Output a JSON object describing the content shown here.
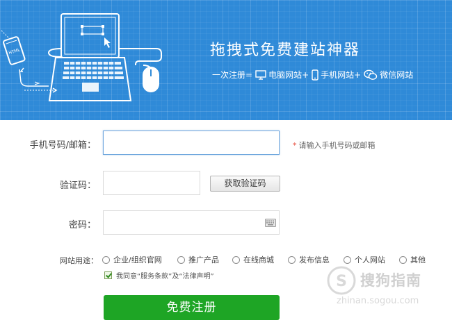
{
  "banner": {
    "title": "拖拽式免费建站神器",
    "subtitle_prefix": "一次注册=",
    "items": [
      {
        "icon": "monitor-icon",
        "label": "电脑网站+"
      },
      {
        "icon": "phone-icon",
        "label": "手机网站+"
      },
      {
        "icon": "wechat-icon",
        "label": "微信网站"
      }
    ],
    "phone_screen_text": "HTML"
  },
  "form": {
    "account_label": "手机号码/邮箱：",
    "account_value": "",
    "account_hint_star": "*",
    "account_hint": "请输入手机号码或邮箱",
    "code_label": "验证码：",
    "code_value": "",
    "code_button": "获取验证码",
    "password_label": "密码：",
    "password_value": "",
    "usage_label": "网站用途：",
    "usage_options": [
      "企业/组织官网",
      "推广产品",
      "在线商城",
      "发布信息",
      "个人网站",
      "其他"
    ],
    "agree_text": "我同意“服务条款”及“法律声明”",
    "agree_checked": true,
    "submit_label": "免费注册"
  },
  "watermark": {
    "text": "搜狗指南",
    "url": "zhinan.sogou.com"
  },
  "colors": {
    "banner_blue": "#2f8ad8",
    "submit_green": "#1ea525",
    "hint_red": "#e74c3c"
  }
}
